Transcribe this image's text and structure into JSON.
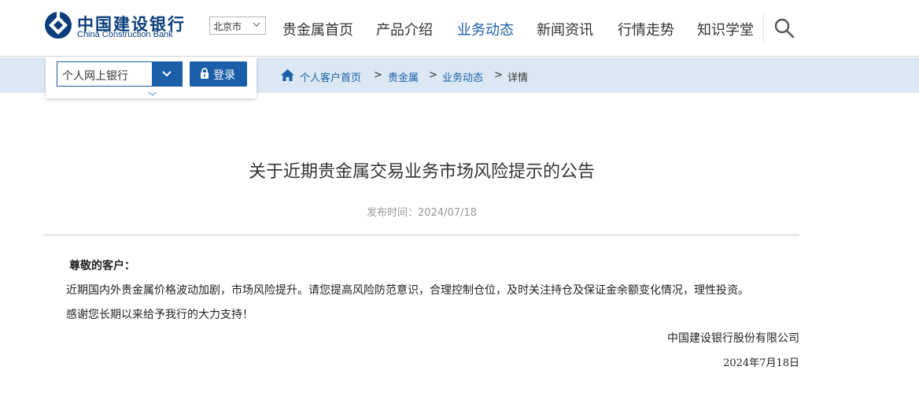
{
  "header": {
    "logo_cn": "中国建设银行",
    "logo_en": "China Construction Bank",
    "city": "北京市",
    "nav": [
      {
        "label": "贵金属首页",
        "active": false
      },
      {
        "label": "产品介绍",
        "active": false
      },
      {
        "label": "业务动态",
        "active": true
      },
      {
        "label": "新闻资讯",
        "active": false
      },
      {
        "label": "行情走势",
        "active": false
      },
      {
        "label": "知识学堂",
        "active": false
      }
    ],
    "search_icon": "search-icon"
  },
  "login": {
    "bank_select_value": "个人网上银行",
    "login_label": "登录"
  },
  "breadcrumb": {
    "items": [
      "个人客户首页",
      "贵金属",
      "业务动态",
      "详情"
    ],
    "separator": ">"
  },
  "article": {
    "title": "关于近期贵金属交易业务市场风险提示的公告",
    "publish": "发布时间：2024/07/18",
    "greeting": "尊敬的客户：",
    "paragraphs": [
      "近期国内外贵金属价格波动加剧，市场风险提升。请您提高风险防范意识，合理控制仓位，及时关注持仓及保证金余额变化情况，理性投资。",
      "感谢您长期以来给予我行的大力支持！"
    ],
    "signature": "中国建设银行股份有限公司",
    "date": "2024年7月18日"
  },
  "colors": {
    "brand_blue": "#1a5fa8",
    "logo_blue": "#0a3d7a",
    "subbar_bg": "#dbe7f3"
  }
}
